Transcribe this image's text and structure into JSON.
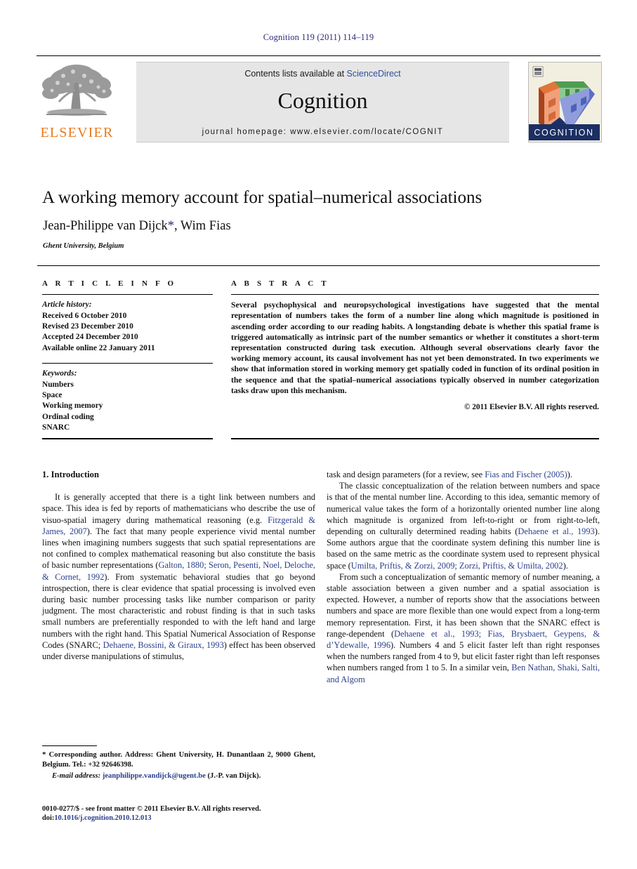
{
  "running_head": "Cognition 119 (2011) 114–119",
  "journal_banner": {
    "contents_prefix": "Contents lists available at ",
    "sciencedirect": "ScienceDirect",
    "journal_title": "Cognition",
    "homepage": "journal homepage: www.elsevier.com/locate/COGNIT",
    "publisher_wordmark": "ELSEVIER",
    "cover_caption": "COGNITION"
  },
  "article": {
    "title": "A working memory account for spatial–numerical associations",
    "authors": "Jean-Philippe van Dijck",
    "corresponding_marker": "*",
    "authors_rest": ", Wim Fias",
    "affiliation": "Ghent University, Belgium"
  },
  "article_info": {
    "heading": "A R T I C L E   I N F O",
    "history_label": "Article history:",
    "history": [
      "Received 6 October 2010",
      "Revised 23 December 2010",
      "Accepted 24 December 2010",
      "Available online 22 January 2011"
    ],
    "keywords_label": "Keywords:",
    "keywords": [
      "Numbers",
      "Space",
      "Working memory",
      "Ordinal coding",
      "SNARC"
    ]
  },
  "abstract": {
    "heading": "A B S T R A C T",
    "text": "Several psychophysical and neuropsychological investigations have suggested that the mental representation of numbers takes the form of a number line along which magnitude is positioned in ascending order according to our reading habits. A longstanding debate is whether this spatial frame is triggered automatically as intrinsic part of the number semantics or whether it constitutes a short-term representation constructed during task execution. Although several observations clearly favor the working memory account, its causal involvement has not yet been demonstrated. In two experiments we show that information stored in working memory get spatially coded in function of its ordinal position in the sequence and that the spatial–numerical associations typically observed in number categorization tasks draw upon this mechanism.",
    "copyright": "© 2011 Elsevier B.V. All rights reserved."
  },
  "body": {
    "section_heading": "1. Introduction",
    "left_paragraph_1_a": "It is generally accepted that there is a tight link between numbers and space. This idea is fed by reports of mathematicians who describe the use of visuo-spatial imagery during mathematical reasoning (e.g. ",
    "ref_fitzgerald": "Fitzgerald & James, 2007",
    "left_paragraph_1_b": "). The fact that many people experience vivid mental number lines when imagining numbers suggests that such spatial representations are not confined to complex mathematical reasoning but also constitute the basis of basic number representations (",
    "ref_galton": "Galton, 1880; Seron, Pesenti, Noel, Deloche, & Cornet, 1992",
    "left_paragraph_1_c": "). From systematic behavioral studies that go beyond introspection, there is clear evidence that spatial processing is involved even during basic number processing tasks like number comparison or parity judgment. The most characteristic and robust finding is that in such tasks small numbers are preferentially responded to with the left hand and large numbers with the right hand. This Spatial Numerical Association of Response Codes (SNARC; ",
    "ref_dehaene1993": "Dehaene, Bossini, & Giraux, 1993",
    "left_paragraph_1_d": ") effect has been observed under diverse manipulations of stimulus, ",
    "right_cont_a": "task and design parameters (for a review, see ",
    "ref_fias_fischer": "Fias and Fischer (2005)",
    "right_cont_b": ").",
    "right_paragraph_2_a": "The classic conceptualization of the relation between numbers and space is that of the mental number line. According to this idea, semantic memory of numerical value takes the form of a horizontally oriented number line along which magnitude is organized from left-to-right or from right-to-left, depending on culturally determined reading habits (",
    "ref_dehaene_etal": "Dehaene et al., 1993",
    "right_paragraph_2_b": "). Some authors argue that the coordinate system defining this number line is based on the same metric as the coordinate system used to represent physical space (",
    "ref_umilta": "Umilta, Priftis, & Zorzi, 2009; Zorzi, Priftis, & Umilta, 2002",
    "right_paragraph_2_c": ").",
    "right_paragraph_3_a": "From such a conceptualization of semantic memory of number meaning, a stable association between a given number and a spatial association is expected. However, a number of reports show that the associations between numbers and space are more flexible than one would expect from a long-term memory representation. First, it has been shown that the SNARC effect is range-dependent (",
    "ref_flias_brysbaert": "Dehaene et al., 1993; Fias, Brysbaert, Geypens, & d’Ydewalle, 1996",
    "right_paragraph_3_b": "). Numbers 4 and 5 elicit faster left than right responses when the numbers ranged from 4 to 9, but elicit faster right than left responses when numbers ranged from 1 to 5. In a similar vein, ",
    "ref_ben_nathan": "Ben Nathan, Shaki, Salti, and Algom"
  },
  "footnote": {
    "star": "*",
    "corresponding": " Corresponding author. Address: Ghent University, H. Dunantlaan 2, 9000 Ghent, Belgium. Tel.: +32 92646398.",
    "email_label": "E-mail address:",
    "email": "jeanphilippe.vandijck@ugent.be",
    "email_suffix": " (J.-P. van Dijck)."
  },
  "issn_line": {
    "text": "0010-0277/$ - see front matter © 2011 Elsevier B.V. All rights reserved.",
    "doi_label": "doi:",
    "doi": "10.1016/j.cognition.2010.12.013"
  },
  "colors": {
    "header_blue": "#2b2b7a",
    "link_blue": "#2b3f8c",
    "sciencedirect_blue": "#2e4ea0",
    "elsevier_orange": "#e87b1e",
    "banner_gray": "#e6e6e6",
    "cover_bg": "#f3efe0"
  }
}
